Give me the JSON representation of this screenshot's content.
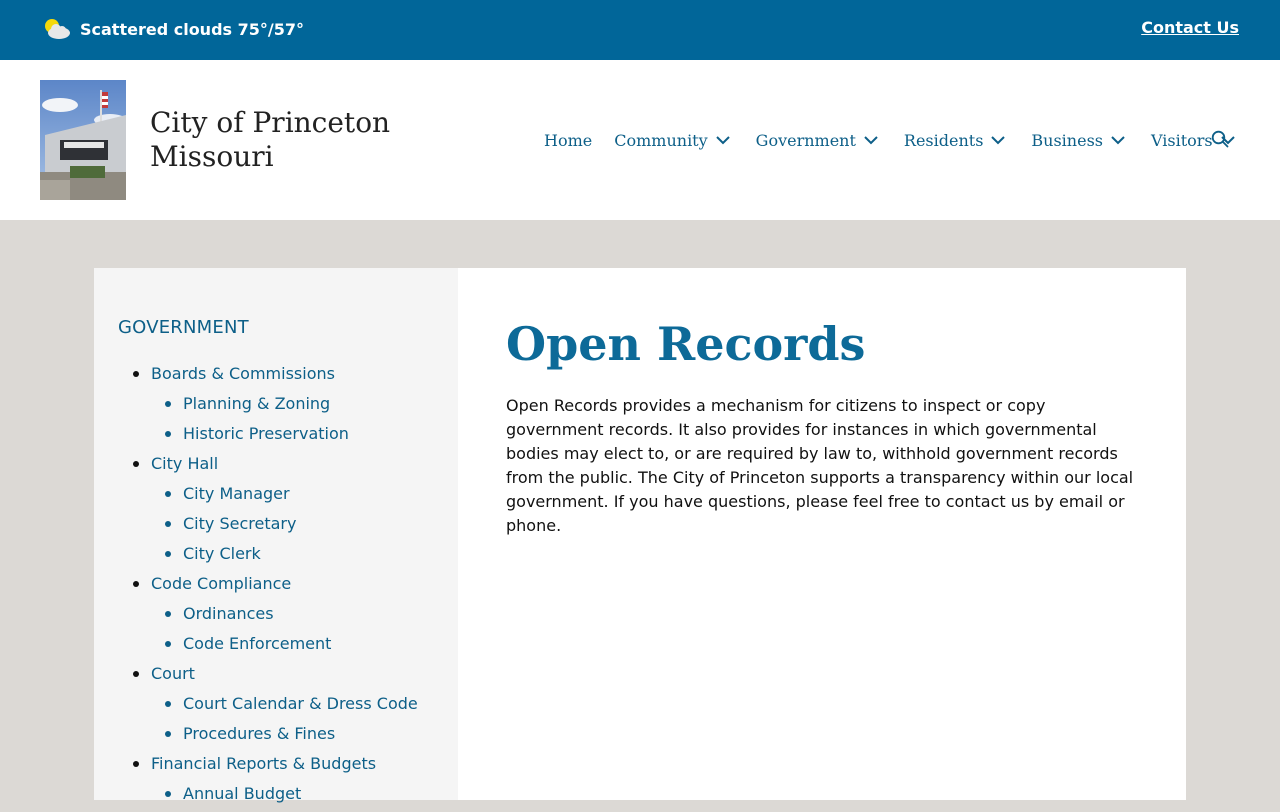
{
  "topbar": {
    "weather_text": "Scattered clouds 75°/57°",
    "weather_icon": "partly-cloudy-icon",
    "contact_label": "Contact Us"
  },
  "header": {
    "site_title_line1": "City of Princeton",
    "site_title_line2": "Missouri"
  },
  "nav": {
    "items": [
      {
        "label": "Home",
        "has_dropdown": false
      },
      {
        "label": "Community",
        "has_dropdown": true
      },
      {
        "label": "Government",
        "has_dropdown": true
      },
      {
        "label": "Residents",
        "has_dropdown": true
      },
      {
        "label": "Business",
        "has_dropdown": true
      },
      {
        "label": "Visitors",
        "has_dropdown": true
      }
    ],
    "search_icon": "search-icon"
  },
  "sidebar": {
    "title": "GOVERNMENT",
    "items": [
      {
        "label": "Boards & Commissions",
        "level": 1
      },
      {
        "label": "Planning & Zoning",
        "level": 2
      },
      {
        "label": "Historic Preservation",
        "level": 2
      },
      {
        "label": "City Hall",
        "level": 1
      },
      {
        "label": "City Manager",
        "level": 2
      },
      {
        "label": "City Secretary",
        "level": 2
      },
      {
        "label": "City Clerk",
        "level": 2
      },
      {
        "label": "Code Compliance",
        "level": 1
      },
      {
        "label": "Ordinances",
        "level": 2
      },
      {
        "label": "Code Enforcement",
        "level": 2
      },
      {
        "label": "Court",
        "level": 1
      },
      {
        "label": "Court Calendar & Dress Code",
        "level": 2
      },
      {
        "label": "Procedures & Fines",
        "level": 2
      },
      {
        "label": "Financial Reports & Budgets",
        "level": 1
      },
      {
        "label": "Annual Budget",
        "level": 2
      }
    ]
  },
  "main": {
    "title": "Open Records",
    "body": "Open Records provides a mechanism for citizens to inspect or copy government records. It also provides for instances in which governmental bodies may elect to, or are required by law to, withhold government records from the public. The City of Princeton supports a transparency within our local government.  If you have questions, please feel free to contact us by email or phone."
  },
  "colors": {
    "topbar_bg": "#016699",
    "link": "#0d5f88",
    "title": "#0d6a98",
    "page_bg": "#dcd9d5",
    "sidebar_bg": "#f5f5f5"
  }
}
